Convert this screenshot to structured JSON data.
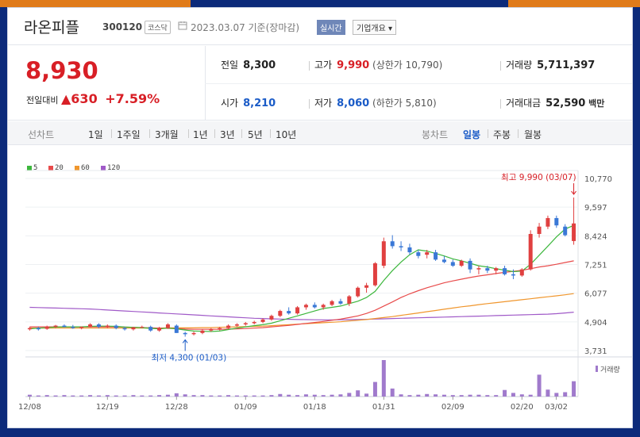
{
  "stock": {
    "name": "라온피플",
    "code": "300120",
    "market": "코스닥",
    "date_text": "2023.03.07 기준(장마감)",
    "realtime_label": "실시간",
    "corp_label": "기업개요 ▾"
  },
  "price": {
    "current": "8,930",
    "change_label": "전일대비",
    "change_arrow": "▲",
    "change_value": "630",
    "change_pct": "+7.59%"
  },
  "stats": {
    "prev_label": "전일",
    "prev_value": "8,300",
    "high_label": "고가",
    "high_value": "9,990",
    "upper_text": "(상한가 10,790)",
    "volume_label": "거래량",
    "volume_value": "5,711,397",
    "open_label": "시가",
    "open_value": "8,210",
    "low_label": "저가",
    "low_value": "8,060",
    "lower_text": "(하한가 5,810)",
    "amount_label": "거래대금",
    "amount_value": "52,590",
    "amount_unit": "백만"
  },
  "periods": {
    "line_label": "선차트",
    "line_items": [
      "1일",
      "1주일",
      "3개월",
      "1년",
      "3년",
      "5년",
      "10년"
    ],
    "candle_label": "봉차트",
    "candle_items": [
      "일봉",
      "주봉",
      "월봉"
    ],
    "candle_selected": "일봉"
  },
  "legend": [
    {
      "name": "5",
      "color": "#3db73d"
    },
    {
      "name": "20",
      "color": "#e84b4b"
    },
    {
      "name": "60",
      "color": "#f0962d"
    },
    {
      "name": "120",
      "color": "#a05ac8"
    }
  ],
  "annotations": {
    "high": "최고 9,990 (03/07)",
    "low": "최저 4,300 (01/03)",
    "volume_label": "거래량"
  },
  "colors": {
    "up": "#d81f26",
    "down": "#1a5bc7",
    "candle_up": "#e04040",
    "candle_down": "#3a78d6",
    "volume": "#a07acc",
    "background": "#0c2a7a",
    "top_strip_left": "#e07b1a",
    "top_strip_right": "#1f3a8a"
  },
  "chart_data": {
    "type": "candlestick",
    "y_ticks": [
      "10,770",
      "9,597",
      "8,424",
      "7,251",
      "6,077",
      "4,904",
      "3,731"
    ],
    "y_tick_values": [
      10770,
      9597,
      8424,
      7251,
      6077,
      4904,
      3731
    ],
    "ylim": [
      3731,
      10770
    ],
    "x_ticks": [
      "12/08",
      "12/19",
      "12/28",
      "01/09",
      "01/18",
      "01/31",
      "02/09",
      "02/20",
      "03/02"
    ],
    "candles": [
      [
        4600,
        4700,
        4550,
        4650
      ],
      [
        4650,
        4700,
        4550,
        4600
      ],
      [
        4620,
        4750,
        4580,
        4700
      ],
      [
        4700,
        4780,
        4650,
        4750
      ],
      [
        4750,
        4800,
        4680,
        4700
      ],
      [
        4700,
        4780,
        4620,
        4650
      ],
      [
        4650,
        4720,
        4600,
        4700
      ],
      [
        4700,
        4850,
        4680,
        4800
      ],
      [
        4800,
        4850,
        4650,
        4700
      ],
      [
        4700,
        4800,
        4650,
        4750
      ],
      [
        4750,
        4800,
        4600,
        4650
      ],
      [
        4650,
        4700,
        4550,
        4600
      ],
      [
        4600,
        4700,
        4550,
        4680
      ],
      [
        4680,
        4750,
        4650,
        4700
      ],
      [
        4700,
        4750,
        4500,
        4550
      ],
      [
        4550,
        4700,
        4500,
        4650
      ],
      [
        4650,
        4850,
        4620,
        4800
      ],
      [
        4750,
        4800,
        4450,
        4450
      ],
      [
        4450,
        4500,
        4300,
        4400
      ],
      [
        4400,
        4500,
        4350,
        4450
      ],
      [
        4450,
        4600,
        4400,
        4550
      ],
      [
        4550,
        4650,
        4500,
        4600
      ],
      [
        4600,
        4700,
        4550,
        4650
      ],
      [
        4650,
        4800,
        4600,
        4750
      ],
      [
        4750,
        4850,
        4700,
        4800
      ],
      [
        4800,
        4900,
        4750,
        4850
      ],
      [
        4850,
        4950,
        4800,
        4900
      ],
      [
        4900,
        5050,
        4850,
        5000
      ],
      [
        5000,
        5200,
        4950,
        5150
      ],
      [
        5150,
        5400,
        5100,
        5350
      ],
      [
        5350,
        5500,
        5200,
        5250
      ],
      [
        5250,
        5550,
        5200,
        5500
      ],
      [
        5500,
        5650,
        5400,
        5600
      ],
      [
        5600,
        5700,
        5450,
        5500
      ],
      [
        5500,
        5650,
        5400,
        5600
      ],
      [
        5600,
        5800,
        5550,
        5750
      ],
      [
        5750,
        5850,
        5600,
        5650
      ],
      [
        5650,
        6000,
        5550,
        5950
      ],
      [
        5950,
        6350,
        5900,
        6300
      ],
      [
        6300,
        6500,
        6100,
        6400
      ],
      [
        6400,
        7350,
        6350,
        7300
      ],
      [
        7200,
        8350,
        7100,
        8200
      ],
      [
        8200,
        8450,
        7900,
        8000
      ],
      [
        8000,
        8200,
        7800,
        7950
      ],
      [
        7950,
        8100,
        7650,
        7750
      ],
      [
        7750,
        7850,
        7500,
        7600
      ],
      [
        7650,
        7850,
        7500,
        7750
      ],
      [
        7750,
        7850,
        7400,
        7450
      ],
      [
        7450,
        7600,
        7300,
        7350
      ],
      [
        7350,
        7450,
        7150,
        7200
      ],
      [
        7200,
        7450,
        7150,
        7400
      ],
      [
        7400,
        7500,
        6900,
        7050
      ],
      [
        7050,
        7200,
        6850,
        7100
      ],
      [
        7100,
        7200,
        6900,
        7000
      ],
      [
        7000,
        7150,
        6850,
        7100
      ],
      [
        7100,
        7200,
        6800,
        6850
      ],
      [
        6850,
        7050,
        6650,
        6800
      ],
      [
        6800,
        7100,
        6750,
        7050
      ],
      [
        7050,
        8650,
        7000,
        8500
      ],
      [
        8500,
        8950,
        8350,
        8800
      ],
      [
        8800,
        9250,
        8700,
        9150
      ],
      [
        9150,
        9250,
        8750,
        8850
      ],
      [
        8800,
        8900,
        8400,
        8450
      ],
      [
        8210,
        9990,
        8060,
        8930
      ]
    ],
    "ma5": [
      4620,
      4650,
      4665,
      4690,
      4700,
      4700,
      4700,
      4720,
      4730,
      4730,
      4720,
      4690,
      4680,
      4670,
      4640,
      4620,
      4650,
      4620,
      4570,
      4530,
      4520,
      4510,
      4530,
      4590,
      4650,
      4700,
      4750,
      4790,
      4850,
      4950,
      5050,
      5150,
      5250,
      5350,
      5450,
      5500,
      5550,
      5650,
      5750,
      5900,
      6150,
      6600,
      7000,
      7350,
      7650,
      7850,
      7800,
      7700,
      7600,
      7480,
      7400,
      7300,
      7200,
      7150,
      7080,
      7020,
      6960,
      6980,
      7260,
      7630,
      8000,
      8380,
      8700,
      8850
    ],
    "ma20": [
      4700,
      4700,
      4700,
      4700,
      4700,
      4700,
      4700,
      4700,
      4700,
      4700,
      4700,
      4690,
      4680,
      4670,
      4660,
      4650,
      4640,
      4630,
      4610,
      4600,
      4600,
      4600,
      4600,
      4610,
      4620,
      4630,
      4650,
      4670,
      4700,
      4730,
      4760,
      4800,
      4840,
      4880,
      4920,
      4970,
      5020,
      5080,
      5150,
      5250,
      5380,
      5550,
      5720,
      5900,
      6050,
      6180,
      6300,
      6400,
      6500,
      6580,
      6650,
      6720,
      6780,
      6830,
      6880,
      6930,
      6970,
      7010,
      7080,
      7150,
      7200,
      7260,
      7330,
      7400
    ],
    "ma60": [
      4650,
      4650,
      4650,
      4650,
      4650,
      4650,
      4650,
      4650,
      4650,
      4650,
      4650,
      4650,
      4650,
      4650,
      4650,
      4650,
      4660,
      4660,
      4660,
      4660,
      4670,
      4670,
      4680,
      4690,
      4700,
      4710,
      4720,
      4730,
      4750,
      4770,
      4790,
      4810,
      4830,
      4850,
      4870,
      4890,
      4910,
      4940,
      4970,
      5000,
      5040,
      5080,
      5120,
      5170,
      5220,
      5270,
      5320,
      5370,
      5420,
      5470,
      5520,
      5560,
      5610,
      5650,
      5690,
      5730,
      5770,
      5810,
      5850,
      5890,
      5930,
      5970,
      6010,
      6060
    ],
    "ma120": [
      5500,
      5490,
      5480,
      5470,
      5460,
      5450,
      5440,
      5430,
      5410,
      5390,
      5370,
      5350,
      5330,
      5310,
      5290,
      5270,
      5250,
      5230,
      5210,
      5190,
      5170,
      5150,
      5130,
      5110,
      5090,
      5070,
      5050,
      5040,
      5030,
      5020,
      5010,
      5000,
      4995,
      4990,
      4985,
      4985,
      4990,
      4995,
      5000,
      5010,
      5020,
      5030,
      5040,
      5050,
      5060,
      5070,
      5080,
      5090,
      5100,
      5110,
      5120,
      5130,
      5140,
      5150,
      5160,
      5170,
      5180,
      5190,
      5200,
      5210,
      5220,
      5240,
      5270,
      5300
    ],
    "volume_rel": [
      0.05,
      0.03,
      0.04,
      0.03,
      0.04,
      0.03,
      0.03,
      0.04,
      0.03,
      0.04,
      0.03,
      0.03,
      0.04,
      0.03,
      0.03,
      0.04,
      0.05,
      0.09,
      0.06,
      0.04,
      0.04,
      0.03,
      0.03,
      0.04,
      0.03,
      0.03,
      0.03,
      0.03,
      0.04,
      0.07,
      0.05,
      0.04,
      0.06,
      0.05,
      0.04,
      0.05,
      0.06,
      0.1,
      0.17,
      0.08,
      0.4,
      1.0,
      0.22,
      0.06,
      0.04,
      0.05,
      0.07,
      0.06,
      0.05,
      0.04,
      0.04,
      0.05,
      0.05,
      0.04,
      0.04,
      0.18,
      0.1,
      0.06,
      0.05,
      0.6,
      0.19,
      0.1,
      0.12,
      0.42
    ],
    "high_point": {
      "value": 9990,
      "label": "최고 9,990 (03/07)"
    },
    "low_point": {
      "value": 4300,
      "label": "최저 4,300 (01/03)"
    },
    "legend_position": "top-left"
  }
}
